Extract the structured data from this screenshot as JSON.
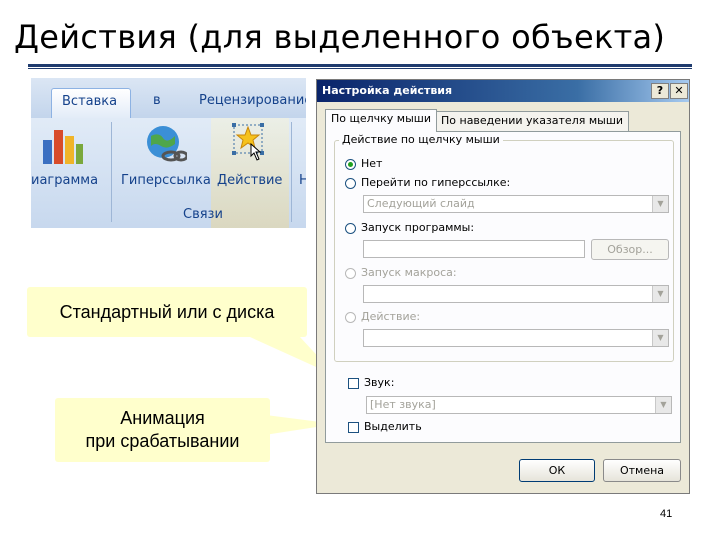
{
  "slide": {
    "title": "Действия (для выделенного объекта)",
    "page_number": "41"
  },
  "ribbon": {
    "tabs": [
      "Вставка",
      "в",
      "Рецензирование"
    ],
    "buttons": {
      "chart": "иаграмма",
      "hyperlink": "Гиперссылка",
      "action": "Действие",
      "cut": "Н"
    },
    "group_label": "Связи"
  },
  "dialog": {
    "title": "Настройка действия",
    "help_btn": "?",
    "close_btn": "✕",
    "tabs": [
      "По щелчку мыши",
      "По наведении указателя мыши"
    ],
    "group_title": "Действие по щелчку мыши",
    "options": {
      "none": "Нет",
      "hyperlink": "Перейти по гиперссылке:",
      "hyperlink_value": "Следующий слайд",
      "run_program": "Запуск программы:",
      "browse": "Обзор...",
      "run_macro": "Запуск макроса:",
      "action": "Действие:"
    },
    "sound_label": "Звук:",
    "sound_value": "[Нет звука]",
    "highlight_label": "Выделить",
    "ok": "ОК",
    "cancel": "Отмена"
  },
  "callouts": {
    "first": "Стандартный или с диска",
    "second_line1": "Анимация",
    "second_line2": "при срабатывании"
  },
  "colors": {
    "title_rule": "#1f3b6e",
    "callout_bg": "#ffffcc",
    "dialog_bg": "#ece9d8",
    "titlebar": "#0a246a"
  }
}
